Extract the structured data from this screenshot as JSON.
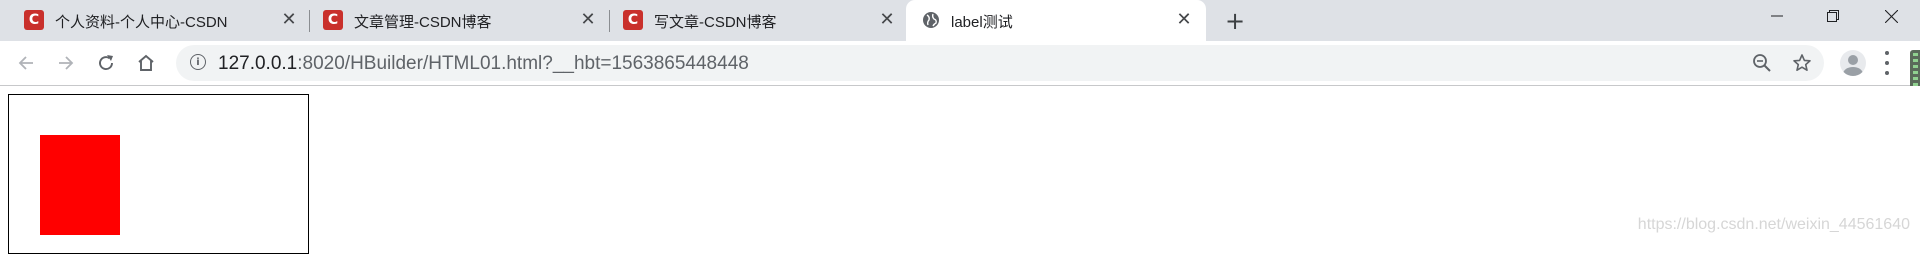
{
  "browser": {
    "tabs": [
      {
        "title": "个人资料-个人中心-CSDN",
        "favicon": "csdn-logo",
        "favicon_letter": "C",
        "active": false
      },
      {
        "title": "文章管理-CSDN博客",
        "favicon": "csdn-logo",
        "favicon_letter": "C",
        "active": false
      },
      {
        "title": "写文章-CSDN博客",
        "favicon": "csdn-logo",
        "favicon_letter": "C",
        "active": false
      },
      {
        "title": "label测试",
        "favicon": "globe-icon",
        "active": true
      }
    ],
    "tab_close_glyph": "✕",
    "new_tab_glyph": "+",
    "address": {
      "host": "127.0.0.1",
      "rest": ":8020/HBuilder/HTML01.html?__hbt=1563865448448",
      "info_glyph": "i"
    },
    "icons": {
      "back": "arrow-left-icon",
      "forward": "arrow-right-icon",
      "reload": "reload-icon",
      "home": "home-icon",
      "zoom": "zoom-out-icon",
      "bookmark": "star-icon",
      "profile": "avatar-icon",
      "menu": "more-vert-icon",
      "minimize": "minimize-icon",
      "restore": "restore-icon",
      "close": "close-icon"
    },
    "colors": {
      "tabstrip": "#dee1e6",
      "csdn_red": "#c9302c"
    }
  },
  "page": {
    "colors": {
      "outer_border": "#000000",
      "inner_box": "#ff0000"
    },
    "watermark": "https://blog.csdn.net/weixin_44561640"
  }
}
